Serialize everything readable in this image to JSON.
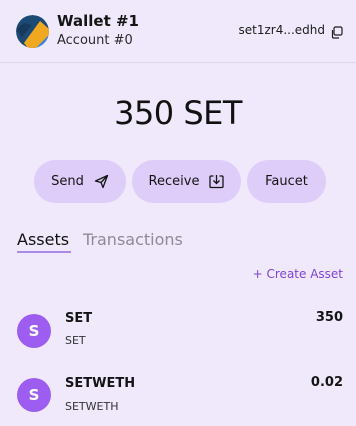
{
  "header": {
    "wallet_title": "Wallet #1",
    "account_name": "Account #0",
    "address": "set1zr4...edhd"
  },
  "balance": {
    "text": "350 SET"
  },
  "actions": {
    "send_label": "Send",
    "receive_label": "Receive",
    "faucet_label": "Faucet"
  },
  "tabs": [
    {
      "label": "Assets",
      "active": true
    },
    {
      "label": "Transactions",
      "active": false
    }
  ],
  "create_asset_label": "+ Create Asset",
  "assets": [
    {
      "badge": "S",
      "symbol": "SET",
      "name": "SET",
      "amount": "350"
    },
    {
      "badge": "S",
      "symbol": "SETWETH",
      "name": "SETWETH",
      "amount": "0.02"
    }
  ],
  "colors": {
    "background": "#efe9fb",
    "button_bg": "#decdf8",
    "accent": "#8043d8",
    "badge": "#9c5df0"
  },
  "icons": {
    "copy": "copy-icon",
    "send": "paper-plane-icon",
    "receive": "download-tray-icon"
  }
}
